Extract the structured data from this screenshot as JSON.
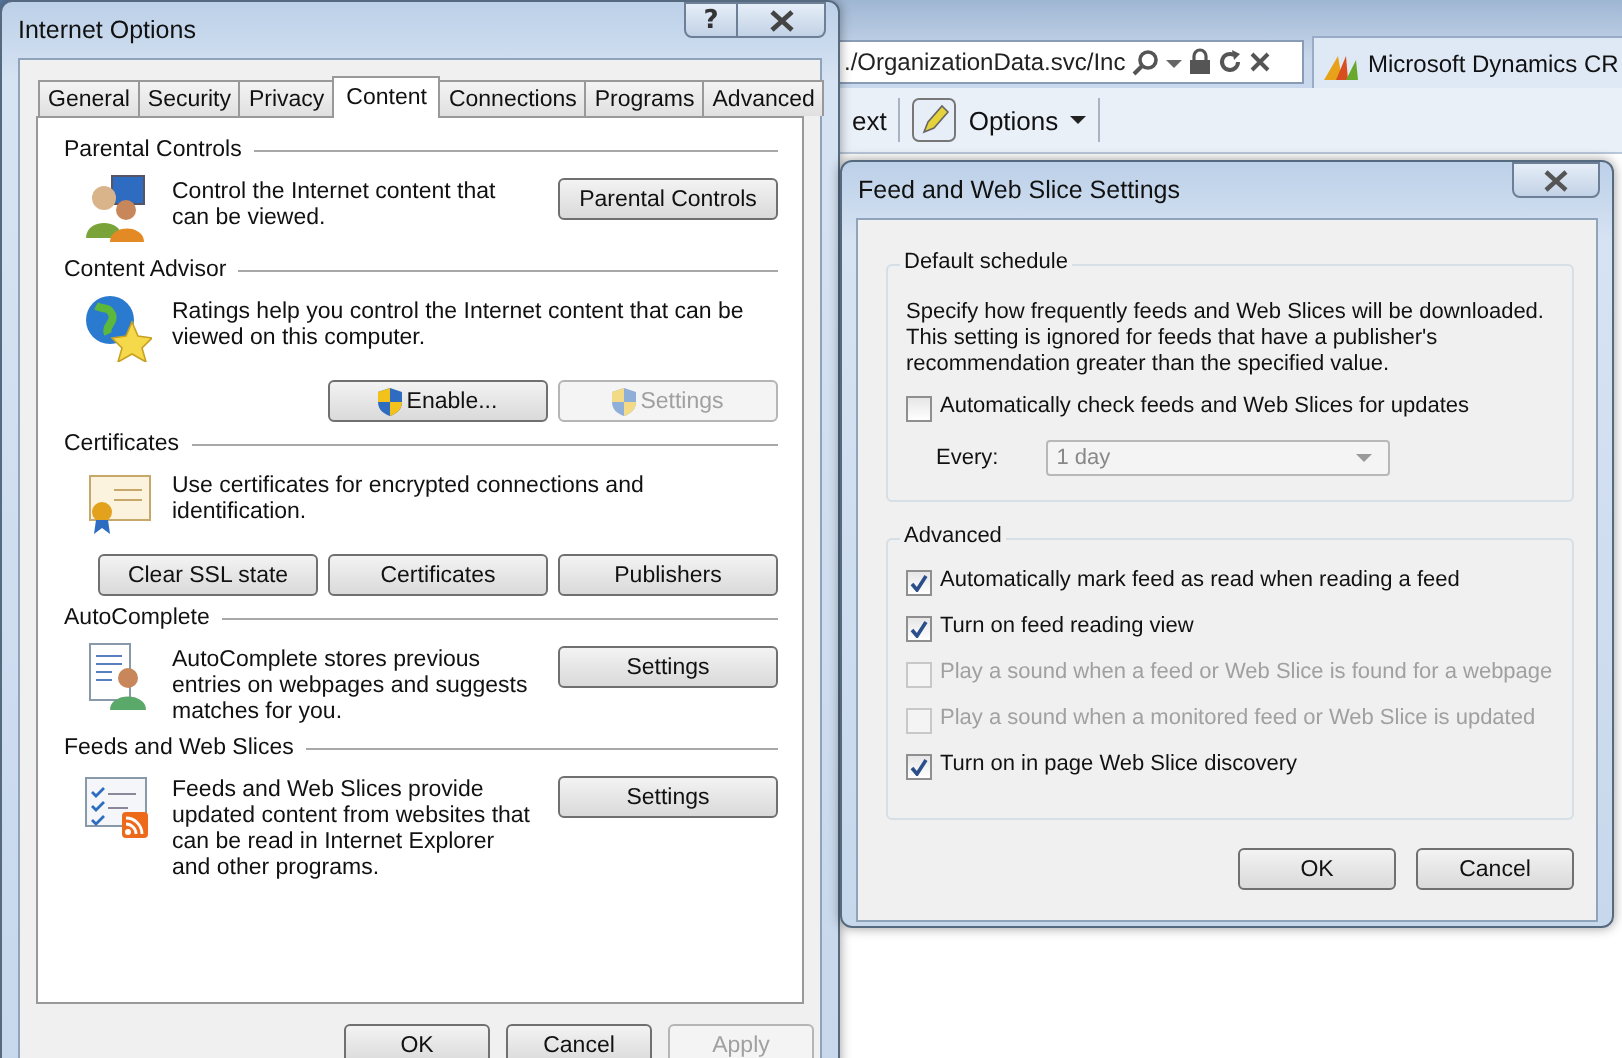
{
  "browser": {
    "address": "./OrganizationData.svc/Inc",
    "tab": "Microsoft Dynamics CR",
    "toolbar_text": "ext",
    "options": "Options"
  },
  "internet_options": {
    "title": "Internet Options",
    "help": "?",
    "tabs": [
      {
        "label": "General",
        "selected": false
      },
      {
        "label": "Security",
        "selected": false
      },
      {
        "label": "Privacy",
        "selected": false
      },
      {
        "label": "Content",
        "selected": true
      },
      {
        "label": "Connections",
        "selected": false
      },
      {
        "label": "Programs",
        "selected": false
      },
      {
        "label": "Advanced",
        "selected": false
      }
    ],
    "sections": [
      {
        "title": "Parental Controls",
        "text": "Control the Internet content that can be viewed.",
        "kind": "side",
        "buttons": [
          {
            "label": "Parental Controls",
            "disabled": false
          }
        ]
      },
      {
        "title": "Content Advisor",
        "text": "Ratings help you control the Internet content that can be viewed on this computer.",
        "kind": "below",
        "buttons": [
          {
            "label": "Enable...",
            "disabled": false,
            "shield": true
          },
          {
            "label": "Settings",
            "disabled": true,
            "shield": true
          }
        ]
      },
      {
        "title": "Certificates",
        "text": "Use certificates for encrypted connections and identification.",
        "kind": "below",
        "buttons": [
          {
            "label": "Clear SSL state",
            "disabled": false
          },
          {
            "label": "Certificates",
            "disabled": false
          },
          {
            "label": "Publishers",
            "disabled": false
          }
        ]
      },
      {
        "title": "AutoComplete",
        "text": "AutoComplete stores previous entries on webpages and suggests matches for you.",
        "kind": "side",
        "buttons": [
          {
            "label": "Settings",
            "disabled": false
          }
        ]
      },
      {
        "title": "Feeds and Web Slices",
        "text": "Feeds and Web Slices provide updated content from websites that can be read in Internet Explorer and other programs.",
        "kind": "side",
        "buttons": [
          {
            "label": "Settings",
            "disabled": false
          }
        ]
      }
    ],
    "buttons": [
      {
        "label": "OK",
        "disabled": false
      },
      {
        "label": "Cancel",
        "disabled": false
      },
      {
        "label": "Apply",
        "disabled": true
      }
    ]
  },
  "feed_settings": {
    "title": "Feed and Web Slice Settings",
    "default_schedule": {
      "title": "Default schedule",
      "text": "Specify how frequently feeds and Web Slices will be downloaded. This setting is ignored for feeds that have a publisher's recommendation greater than the specified value.",
      "check": {
        "label": "Automatically check feeds and Web Slices for updates",
        "checked": false,
        "disabled": false
      },
      "every_label": "Every:",
      "every_value": "1 day",
      "every_disabled": true
    },
    "advanced": {
      "title": "Advanced",
      "options": [
        {
          "label": "Automatically mark feed as read when reading a feed",
          "checked": true,
          "disabled": false
        },
        {
          "label": "Turn on feed reading view",
          "checked": true,
          "disabled": false
        },
        {
          "label": "Play a sound when a feed or Web Slice is found for a webpage",
          "checked": false,
          "disabled": true
        },
        {
          "label": "Play a sound when a monitored feed or Web Slice is updated",
          "checked": false,
          "disabled": true
        },
        {
          "label": "Turn on in page Web Slice discovery",
          "checked": true,
          "disabled": false
        }
      ]
    },
    "buttons": [
      {
        "label": "OK",
        "disabled": false
      },
      {
        "label": "Cancel",
        "disabled": false
      }
    ]
  }
}
